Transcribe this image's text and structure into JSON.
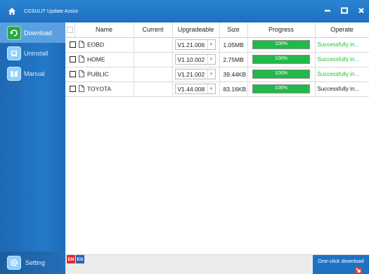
{
  "window": {
    "title": "CGSULIT Update Assist",
    "controls": {
      "minimize": "–",
      "maximize": "□",
      "close": "✕"
    }
  },
  "sidebar": {
    "items": [
      {
        "label": "Download",
        "icon": "download-icon",
        "active": true
      },
      {
        "label": "Uninstall",
        "icon": "uninstall-icon",
        "active": false
      },
      {
        "label": "Manual",
        "icon": "manual-icon",
        "active": false
      }
    ],
    "setting": {
      "label": "Setting",
      "icon": "gear-icon"
    }
  },
  "table": {
    "headers": [
      "Name",
      "Current",
      "Upgradeable",
      "Size",
      "Progress",
      "Operate"
    ],
    "rows": [
      {
        "name": "EOBD",
        "current": "",
        "upgradeable": "V1.21.006",
        "size": "1.05MB",
        "progress": 100,
        "progress_label": "100%",
        "operate": "Successfully in...",
        "operate_color": "#22c238"
      },
      {
        "name": "HOME",
        "current": "",
        "upgradeable": "V1.10.002",
        "size": "2.75MB",
        "progress": 100,
        "progress_label": "100%",
        "operate": "Successfully in...",
        "operate_color": "#22c238"
      },
      {
        "name": "PUBLIC",
        "current": "",
        "upgradeable": "V1.21.002",
        "size": "39.44KB",
        "progress": 100,
        "progress_label": "100%",
        "operate": "Successfully in...",
        "operate_color": "#22c238"
      },
      {
        "name": "TOYOTA",
        "current": "",
        "upgradeable": "V1.44.008",
        "size": "83.16KB",
        "progress": 100,
        "progress_label": "100%",
        "operate": "Successfully in...",
        "operate_color": "#222222"
      }
    ]
  },
  "bottom": {
    "languages": [
      "EN",
      "ES"
    ],
    "one_click_label": "One-click download"
  },
  "colors": {
    "title_bar": "#2a84d2",
    "sidebar": "#2379c8",
    "progress_fill": "#22b84a",
    "success_text": "#22c238"
  }
}
